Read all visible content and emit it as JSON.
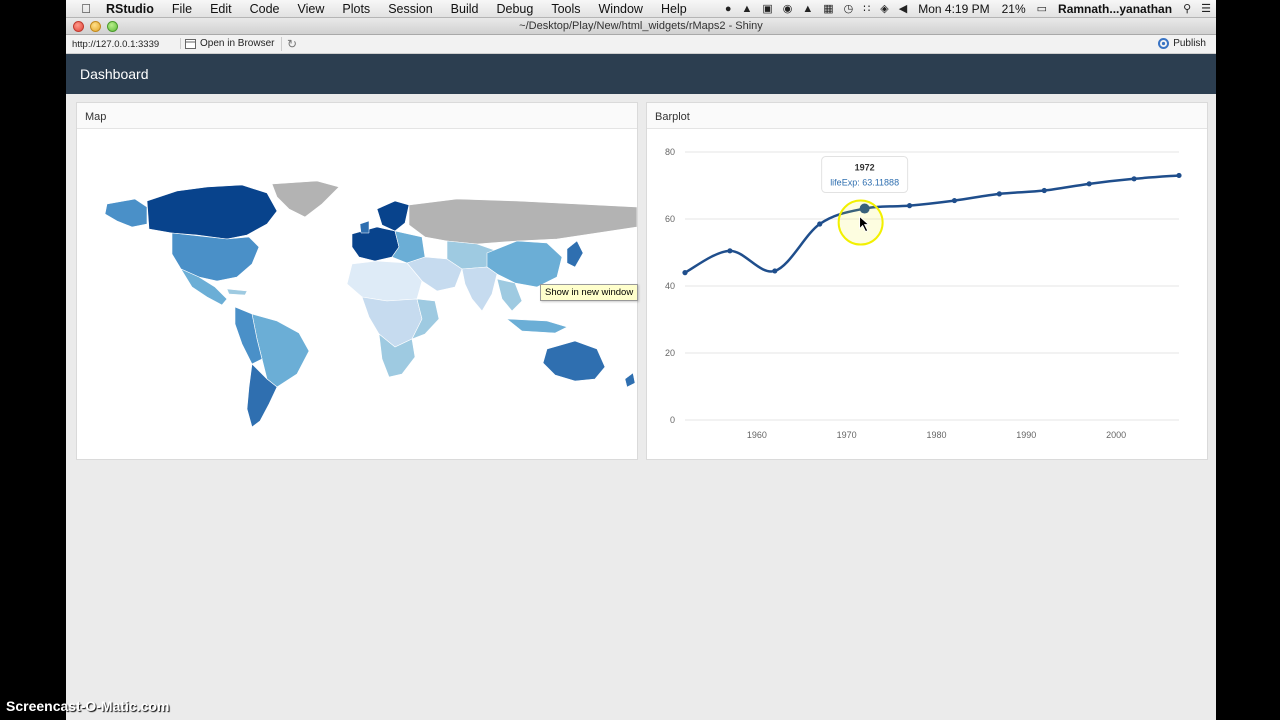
{
  "menubar": {
    "app": "RStudio",
    "items": [
      "File",
      "Edit",
      "Code",
      "View",
      "Plots",
      "Session",
      "Build",
      "Debug",
      "Tools",
      "Window",
      "Help"
    ],
    "clock": "Mon 4:19 PM",
    "battery": "21%",
    "user": "Ramnath...yanathan"
  },
  "window": {
    "title": "~/Desktop/Play/New/html_widgets/rMaps2 - Shiny"
  },
  "toolbar": {
    "url": "http://127.0.0.1:3339",
    "open_browser": "Open in Browser",
    "publish": "Publish"
  },
  "dashboard": {
    "title": "Dashboard"
  },
  "panels": {
    "map_title": "Map",
    "bar_title": "Barplot",
    "map_tooltip": "Show in new window"
  },
  "colors": {
    "header_bg": "#2c3e50",
    "line": "#1f4e8c",
    "highlight": "#f2f000"
  },
  "chart_data": {
    "type": "line",
    "title": "",
    "xlabel": "",
    "ylabel": "",
    "ylim": [
      0,
      80
    ],
    "xlim": [
      1952,
      2007
    ],
    "yticks": [
      "0",
      "20",
      "40",
      "60",
      "80"
    ],
    "xticks": [
      "1960",
      "1970",
      "1980",
      "1990",
      "2000"
    ],
    "grid": true,
    "series": [
      {
        "x": [
          1952,
          1957,
          1962,
          1967,
          1972,
          1977,
          1982,
          1987,
          1992,
          1997,
          2002,
          2007
        ],
        "values": [
          44,
          50.5,
          44.5,
          58.5,
          63.11888,
          64,
          65.5,
          67.5,
          68.5,
          70.5,
          72,
          73
        ]
      }
    ],
    "tooltip": {
      "year": "1972",
      "text": "lifeExp: 63.11888"
    }
  },
  "watermark": "Screencast-O-Matic.com"
}
